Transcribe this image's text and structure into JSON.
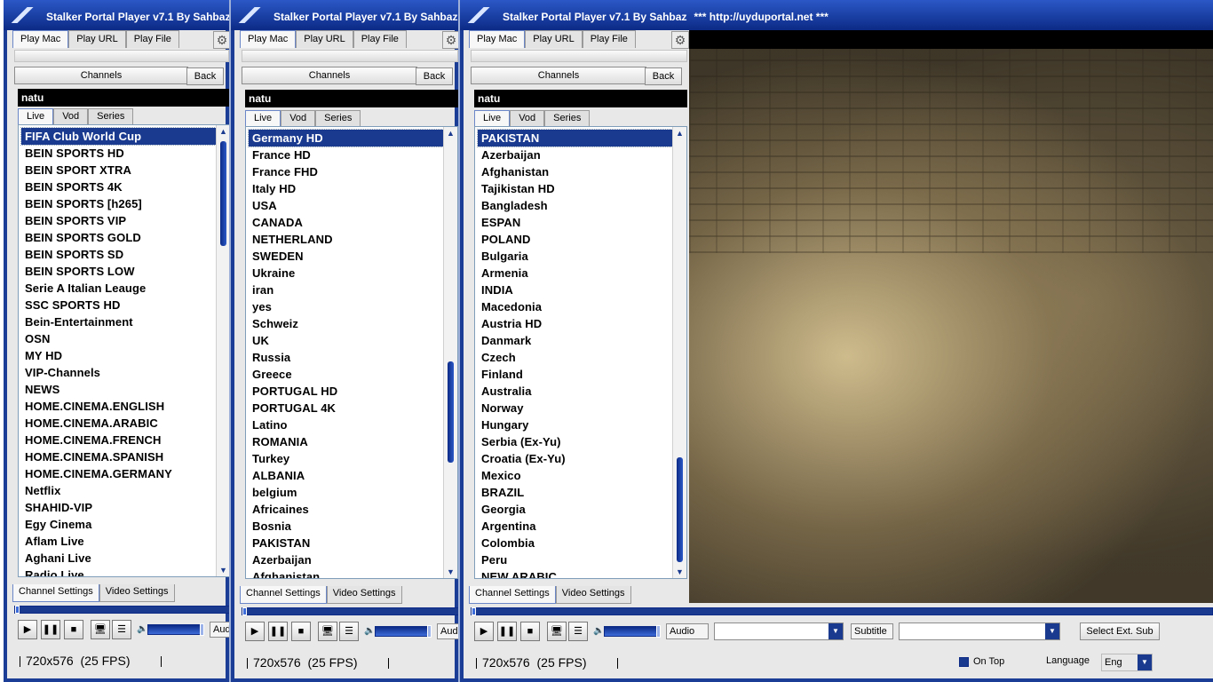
{
  "windows": [
    {
      "title": "Stalker Portal Player v7.1 By Sahbaz",
      "tabs": [
        "Play Mac",
        "Play URL",
        "Play File"
      ],
      "channels_label": "Channels",
      "back_label": "Back",
      "search_value": "natu",
      "subtabs": [
        "Live",
        "Vod",
        "Series"
      ],
      "channels": [
        "FIFA Club World Cup",
        "BEIN SPORTS HD",
        "BEIN SPORT XTRA",
        "BEIN SPORTS 4K",
        "BEIN SPORTS [h265]",
        "BEIN SPORTS VIP",
        "BEIN SPORTS GOLD",
        "BEIN SPORTS SD",
        "BEIN SPORTS LOW",
        "Serie A Italian Leauge",
        "SSC SPORTS  HD",
        "Bein-Entertainment",
        "OSN",
        "MY HD",
        "VIP-Channels",
        "NEWS",
        "HOME.CINEMA.ENGLISH",
        "HOME.CINEMA.ARABIC",
        "HOME.CINEMA.FRENCH",
        "HOME.CINEMA.SPANISH",
        "HOME.CINEMA.GERMANY",
        "Netflix",
        "SHAHID-VIP",
        "Egy Cinema",
        "Aflam Live",
        "Aghani Live",
        "Radio Live"
      ],
      "bottom_tabs": [
        "Channel Settings",
        "Video Settings"
      ],
      "audio_label": "Audio",
      "resolution": "720x576",
      "fps": "(25 FPS)"
    },
    {
      "title": "Stalker Portal Player v7.1 By Sahbaz",
      "tabs": [
        "Play Mac",
        "Play URL",
        "Play File"
      ],
      "channels_label": "Channels",
      "back_label": "Back",
      "search_value": "natu",
      "subtabs": [
        "Live",
        "Vod",
        "Series"
      ],
      "channels": [
        "Germany HD",
        "France HD",
        "France FHD",
        "Italy HD",
        "USA",
        "CANADA",
        "NETHERLAND",
        "SWEDEN",
        "Ukraine",
        "iran",
        "yes",
        "Schweiz",
        "UK",
        "Russia",
        "Greece",
        "PORTUGAL HD",
        "PORTUGAL 4K",
        "Latino",
        "ROMANIA",
        "Turkey",
        "ALBANIA",
        "belgium",
        "Africaines",
        "Bosnia",
        "PAKISTAN",
        "Azerbaijan",
        "Afghanistan"
      ],
      "bottom_tabs": [
        "Channel Settings",
        "Video Settings"
      ],
      "audio_label": "Audio",
      "resolution": "720x576",
      "fps": "(25 FPS)"
    },
    {
      "title": "Stalker Portal Player v7.1 By Sahbaz",
      "title_extra": "*** http://uyduportal.net ***",
      "tabs": [
        "Play Mac",
        "Play URL",
        "Play File"
      ],
      "channels_label": "Channels",
      "back_label": "Back",
      "search_value": "natu",
      "subtabs": [
        "Live",
        "Vod",
        "Series"
      ],
      "channels": [
        "PAKISTAN",
        "Azerbaijan",
        "Afghanistan",
        "Tajikistan HD",
        "Bangladesh",
        "ESPAN",
        "POLAND",
        "Bulgaria",
        "Armenia",
        "INDIA",
        "Macedonia",
        "Austria HD",
        "Danmark",
        "Czech",
        "Finland",
        "Australia",
        "Norway",
        "Hungary",
        "Serbia (Ex-Yu)",
        "Croatia (Ex-Yu)",
        "Mexico",
        "BRAZIL",
        "Georgia",
        "Argentina",
        "Colombia",
        "Peru",
        "NEW ARABIC"
      ],
      "bottom_tabs": [
        "Channel Settings",
        "Video Settings"
      ],
      "audio_label": "Audio",
      "subtitle_label": "Subtitle",
      "select_ext_sub_label": "Select Ext. Sub",
      "on_top_label": "On Top",
      "language_label": "Language",
      "language_value": "Eng",
      "resolution": "720x576",
      "fps": "(25 FPS)"
    }
  ],
  "icons": {
    "play": "play-icon",
    "pause": "pause-icon",
    "stop": "stop-icon",
    "screen": "monitor-icon",
    "playlist": "playlist-icon",
    "volume": "speaker-icon",
    "settings": "gear-icon"
  },
  "colors": {
    "title_bar": "#1b3d95",
    "selection": "#1a3a8f",
    "search_bg": "#000000"
  }
}
